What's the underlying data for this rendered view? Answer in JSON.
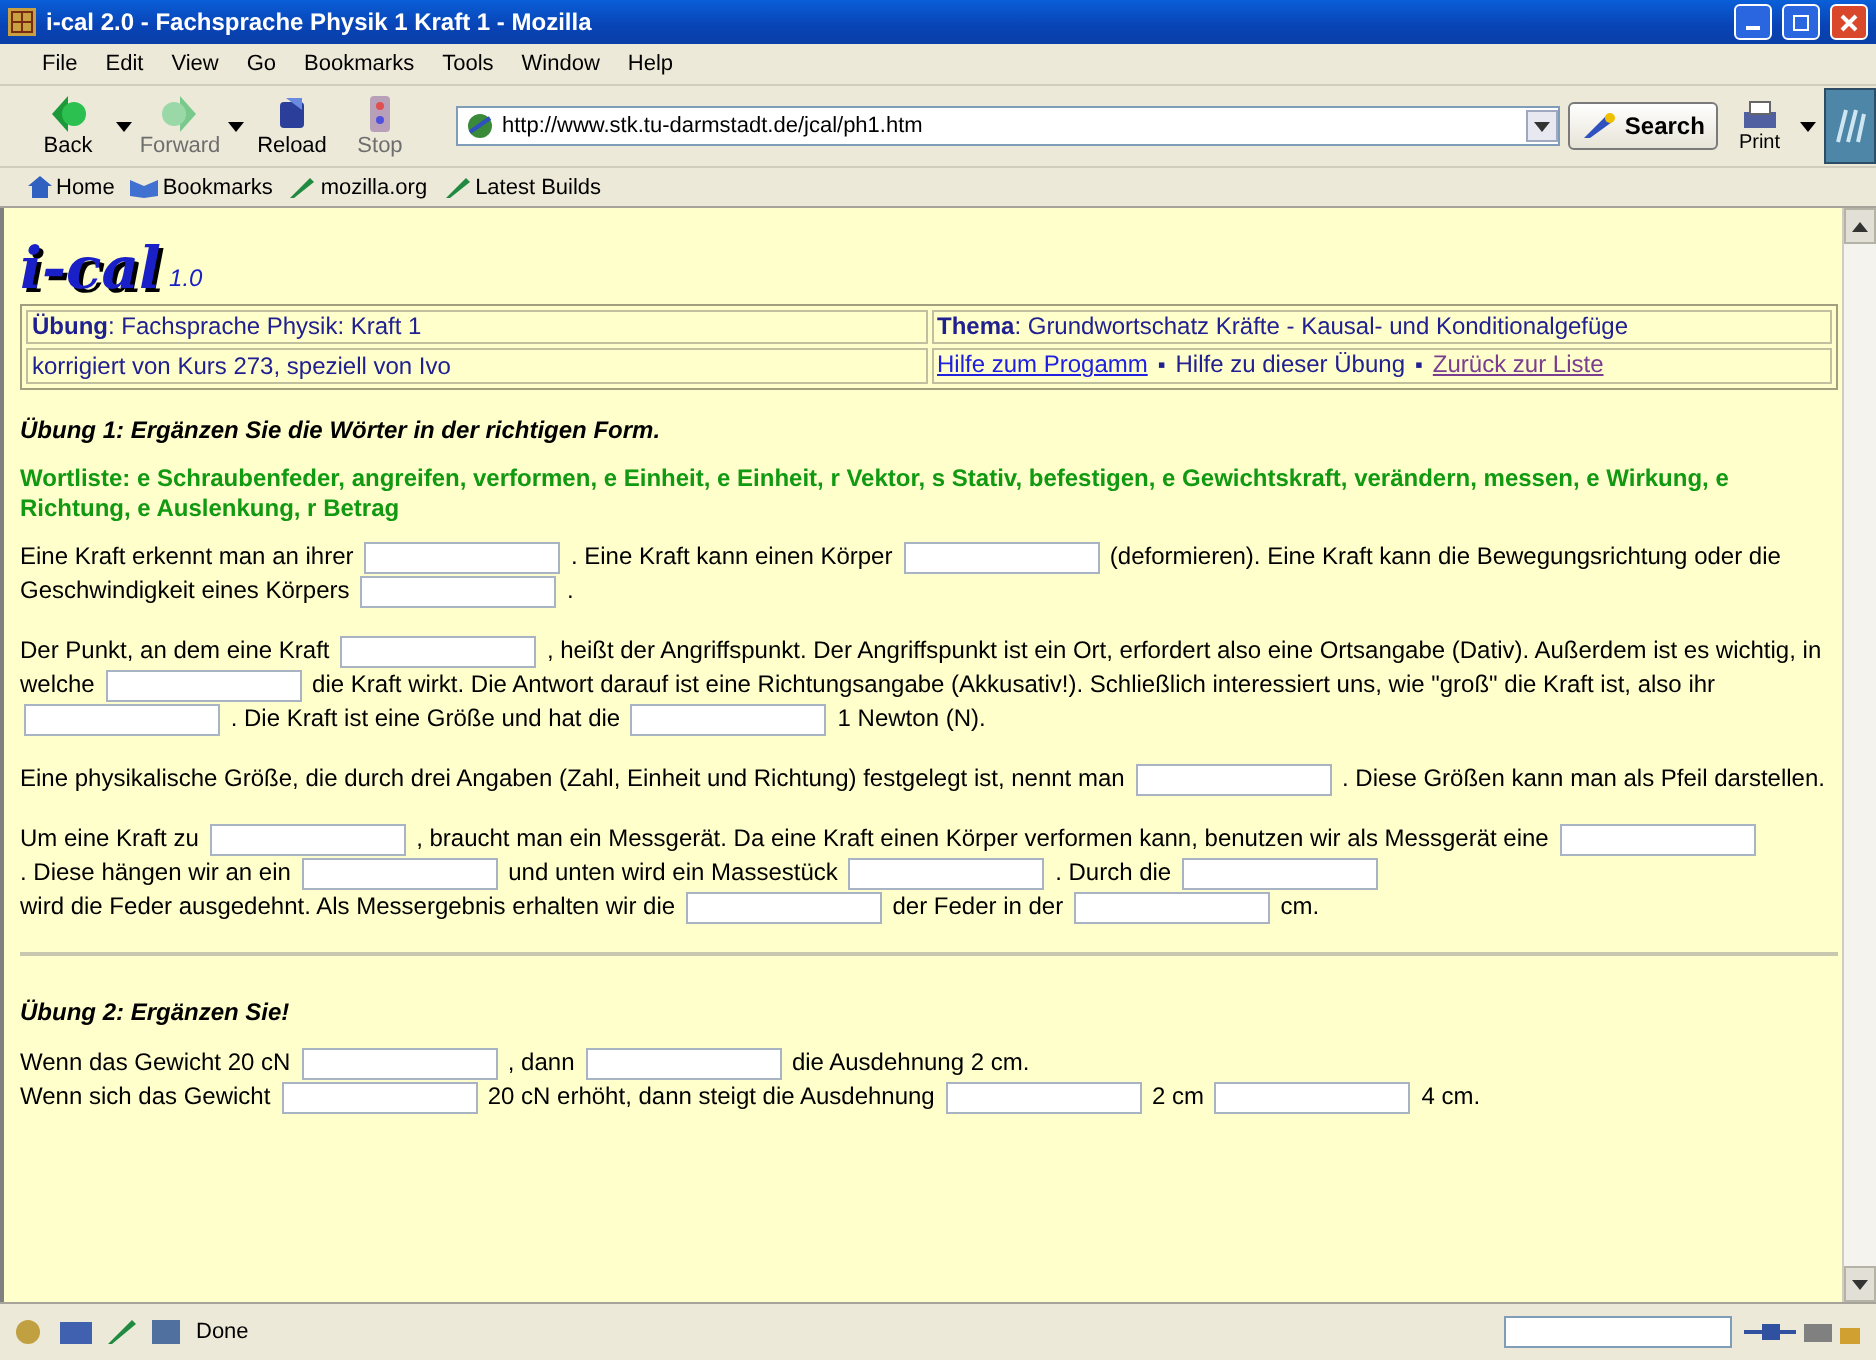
{
  "window": {
    "title": "i-cal 2.0 - Fachsprache Physik 1 Kraft 1 - Mozilla"
  },
  "menu": [
    "File",
    "Edit",
    "View",
    "Go",
    "Bookmarks",
    "Tools",
    "Window",
    "Help"
  ],
  "nav_buttons": [
    {
      "kind": "back",
      "label": "Back",
      "disabled": false,
      "dropdown": true
    },
    {
      "kind": "forward",
      "label": "Forward",
      "disabled": true,
      "dropdown": true
    },
    {
      "kind": "reload",
      "label": "Reload",
      "disabled": false,
      "dropdown": false
    },
    {
      "kind": "stop",
      "label": "Stop",
      "disabled": true,
      "dropdown": false
    }
  ],
  "address": "http://www.stk.tu-darmstadt.de/jcal/ph1.htm",
  "search_button": "Search",
  "print_button": "Print",
  "personal_bar": [
    {
      "kind": "home",
      "label": "Home"
    },
    {
      "kind": "bookmarks",
      "label": "Bookmarks"
    },
    {
      "kind": "link",
      "label": "mozilla.org"
    },
    {
      "kind": "link",
      "label": "Latest Builds"
    }
  ],
  "page": {
    "logo": "i-cal",
    "version": "1.0",
    "info": {
      "exercise_label": "Übung",
      "exercise": ": Fachsprache Physik: Kraft 1",
      "topic_label": "Thema",
      "topic": ": Grundwortschatz Kräfte - Kausal- und Konditionalgefüge",
      "corrected": "korrigiert von Kurs 273, speziell von Ivo",
      "links": [
        {
          "kind": "link",
          "text": "Hilfe zum Progamm",
          "visited": false
        },
        {
          "kind": "text",
          "bullet": "▪",
          "text": "Hilfe zu dieser Übung"
        },
        {
          "kind": "link",
          "bullet": "▪",
          "text": "Zurück zur Liste",
          "visited": true
        }
      ]
    },
    "exercises": [
      {
        "heading": "Übung 1: Ergänzen Sie die Wörter in der richtigen Form.",
        "wordlist": "Wortliste: e Schraubenfeder, angreifen, verformen, e Einheit, e Einheit, r Vektor, s Stativ, befestigen, e Gewichtskraft, verändern, messen, e Wirkung, e Richtung, e Auslenkung, r Betrag",
        "paragraphs": [
          [
            {
              "kind": "text",
              "text": "Eine Kraft erkennt man an ihrer"
            },
            {
              "kind": "blank"
            },
            {
              "kind": "text",
              "text": ". Eine Kraft kann einen Körper"
            },
            {
              "kind": "blank"
            },
            {
              "kind": "text",
              "text": "(deformieren). Eine Kraft kann die Bewegungsrichtung oder die"
            },
            {
              "kind": "text",
              "text": "Geschwindigkeit eines Körpers"
            },
            {
              "kind": "blank"
            },
            {
              "kind": "text",
              "text": "."
            }
          ],
          [
            {
              "kind": "text",
              "text": "Der Punkt, an dem eine Kraft"
            },
            {
              "kind": "blank"
            },
            {
              "kind": "text",
              "text": ", heißt der Angriffspunkt. Der Angriffspunkt ist ein Ort, erfordert also eine Ortsangabe (Dativ). Außerdem ist es wichtig, in"
            },
            {
              "kind": "text",
              "text": "welche"
            },
            {
              "kind": "blank"
            },
            {
              "kind": "text",
              "text": "die Kraft wirkt. Die Antwort darauf ist eine Richtungsangabe (Akkusativ!). Schließlich interessiert uns, wie \"groß\" die Kraft ist, also ihr"
            },
            {
              "kind": "blank"
            },
            {
              "kind": "text",
              "text": ". Die Kraft ist eine Größe und hat die"
            },
            {
              "kind": "blank"
            },
            {
              "kind": "text",
              "text": "1 Newton (N)."
            }
          ],
          [
            {
              "kind": "text",
              "text": "Eine physikalische Größe, die durch drei Angaben (Zahl, Einheit und Richtung) festgelegt ist, nennt man"
            },
            {
              "kind": "blank"
            },
            {
              "kind": "text",
              "text": ". Diese Größen kann man als Pfeil darstellen."
            }
          ],
          [
            {
              "kind": "text",
              "text": "Um eine Kraft zu"
            },
            {
              "kind": "blank"
            },
            {
              "kind": "text",
              "text": ", braucht man ein Messgerät. Da eine Kraft einen Körper verformen kann, benutzen wir als Messgerät eine"
            },
            {
              "kind": "blank"
            },
            {
              "kind": "text",
              "text": ". Diese"
            },
            {
              "kind": "text",
              "text": "hängen wir an ein"
            },
            {
              "kind": "blank"
            },
            {
              "kind": "text",
              "text": "und unten wird ein Massestück"
            },
            {
              "kind": "blank"
            },
            {
              "kind": "text",
              "text": ". Durch die"
            },
            {
              "kind": "blank"
            },
            {
              "kind": "text",
              "text": "wird die Feder ausgedehnt. Als Messergebnis"
            },
            {
              "kind": "text",
              "text": "erhalten wir die"
            },
            {
              "kind": "blank"
            },
            {
              "kind": "text",
              "text": "der Feder in der"
            },
            {
              "kind": "blank"
            },
            {
              "kind": "text",
              "text": "cm."
            }
          ]
        ]
      },
      {
        "heading": "Übung 2: Ergänzen Sie!",
        "lines": [
          [
            {
              "kind": "text",
              "text": "Wenn das Gewicht 20 cN"
            },
            {
              "kind": "blank"
            },
            {
              "kind": "text",
              "text": ", dann"
            },
            {
              "kind": "blank"
            },
            {
              "kind": "text",
              "text": "die Ausdehnung 2 cm."
            }
          ],
          [
            {
              "kind": "text",
              "text": "Wenn sich das Gewicht"
            },
            {
              "kind": "blank"
            },
            {
              "kind": "text",
              "text": "20 cN erhöht, dann steigt die Ausdehnung"
            },
            {
              "kind": "blank"
            },
            {
              "kind": "text",
              "text": "2 cm"
            },
            {
              "kind": "blank"
            },
            {
              "kind": "text",
              "text": "4 cm."
            }
          ]
        ]
      }
    ]
  },
  "status_bar": {
    "text": "Done"
  }
}
